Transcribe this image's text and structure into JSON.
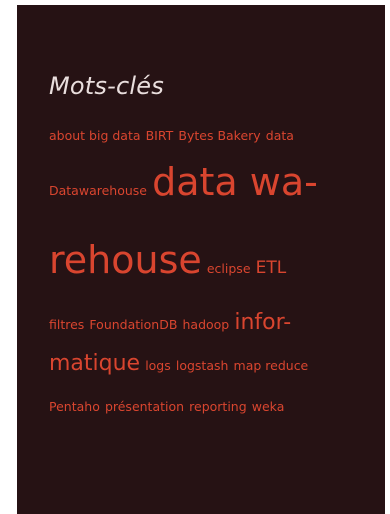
{
  "widget": {
    "title": "Mots-clés",
    "tags": [
      {
        "id": "about-big-data",
        "label": "about big data"
      },
      {
        "id": "birt",
        "label": "BIRT"
      },
      {
        "id": "bytes-bakery",
        "label": "Bytes Bakery"
      },
      {
        "id": "data",
        "label": "data"
      },
      {
        "id": "datawarehouse",
        "label": "Datawarehouse"
      },
      {
        "id": "data-warehouse-1",
        "label": "data wa-"
      },
      {
        "id": "data-warehouse-2",
        "label": "rehouse"
      },
      {
        "id": "eclipse",
        "label": "eclipse"
      },
      {
        "id": "etl",
        "label": "ETL"
      },
      {
        "id": "filtres",
        "label": "filtres"
      },
      {
        "id": "foundationdb",
        "label": "FoundationDB"
      },
      {
        "id": "hadoop",
        "label": "hadoop"
      },
      {
        "id": "informatique-1",
        "label": "infor-"
      },
      {
        "id": "informatique-2",
        "label": "matique"
      },
      {
        "id": "logs",
        "label": "logs"
      },
      {
        "id": "logstash",
        "label": "logstash"
      },
      {
        "id": "map-reduce",
        "label": "map reduce"
      },
      {
        "id": "pentaho",
        "label": "Pentaho"
      },
      {
        "id": "presentation",
        "label": "présentation"
      },
      {
        "id": "reporting",
        "label": "reporting"
      },
      {
        "id": "weka",
        "label": "weka"
      }
    ]
  },
  "colors": {
    "background": "#261214",
    "title": "#e9dedd",
    "tag": "#d9452f",
    "page": "#ffffff"
  }
}
